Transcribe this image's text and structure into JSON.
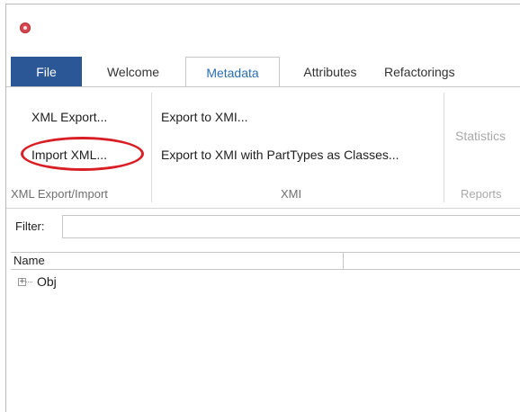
{
  "tabs": {
    "file": "File",
    "welcome": "Welcome",
    "metadata": "Metadata",
    "attributes": "Attributes",
    "refactorings": "Refactorings"
  },
  "ribbon": {
    "xml_export": "XML Export...",
    "import_xml": "Import XML...",
    "group_xml": "XML Export/Import",
    "export_to_xmi": "Export to XMI...",
    "export_xmi_parttypes": "Export to XMI with PartTypes as Classes...",
    "group_xmi": "XMI",
    "statistics": "Statistics",
    "group_reports": "Reports"
  },
  "filter": {
    "label": "Filter:",
    "value": ""
  },
  "grid": {
    "columns": [
      "Name",
      ""
    ],
    "rows": [
      {
        "expander": "+",
        "label": "Obj"
      }
    ]
  },
  "colors": {
    "file_tab": "#2b5797",
    "active_tab_text": "#2b6fb0",
    "highlight": "#d81f26",
    "app_icon": "#d7474f"
  }
}
